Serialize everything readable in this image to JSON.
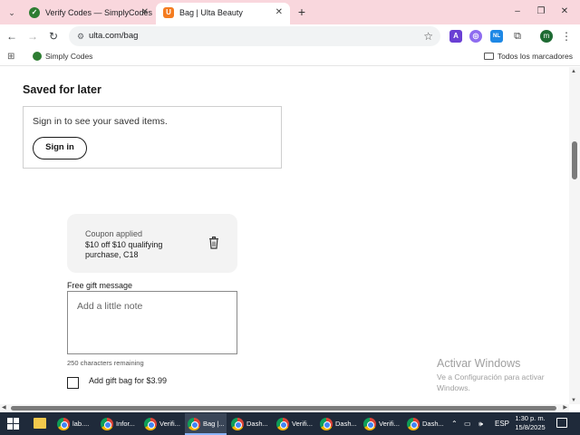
{
  "browser": {
    "tabs": [
      {
        "title": "Verify Codes — SimplyCodes",
        "active": false
      },
      {
        "title": "Bag | Ulta Beauty",
        "active": true
      }
    ],
    "new_tab": "+",
    "window_controls": {
      "minimize": "–",
      "maximize": "❐",
      "close": "✕"
    },
    "url": "ulta.com/bag",
    "extensions": [
      {
        "name": "A",
        "color": "#6a3fd4"
      },
      {
        "name": "◎",
        "color": "#8e6cf0"
      },
      {
        "name": "NL",
        "color": "#1e88e5"
      }
    ],
    "profile_initial": "m",
    "bookmarks": {
      "items": [
        {
          "label": "Simply Codes"
        }
      ],
      "all_bookmarks": "Todos los marcadores"
    }
  },
  "page": {
    "saved_for_later": {
      "title": "Saved for later",
      "message": "Sign in to see your saved items.",
      "button": "Sign in"
    },
    "coupon": {
      "status": "Coupon applied",
      "description": "$10 off $10 qualifying purchase, C18"
    },
    "gift_message": {
      "label": "Free gift message",
      "placeholder": "Add a little note",
      "chars_remaining": "250 characters remaining"
    },
    "gift_bag": {
      "label": "Add gift bag for $3.99",
      "checked": false
    }
  },
  "watermark": {
    "title": "Activar Windows",
    "subtitle": "Ve a Configuración para activar Windows."
  },
  "taskbar": {
    "items": [
      {
        "label": "lab...."
      },
      {
        "label": "Infor..."
      },
      {
        "label": "Verifi..."
      },
      {
        "label": "Bag |..."
      },
      {
        "label": "Dash..."
      },
      {
        "label": "Verifi..."
      },
      {
        "label": "Dash..."
      },
      {
        "label": "Verifi..."
      },
      {
        "label": "Dash..."
      }
    ],
    "language": "ESP",
    "time": "1:30 p. m.",
    "date": "15/8/2025"
  },
  "colors": {
    "tabbar_bg": "#f9d7dd",
    "taskbar_bg": "#1f2a3a",
    "coupon_bg": "#f3f3f3"
  }
}
